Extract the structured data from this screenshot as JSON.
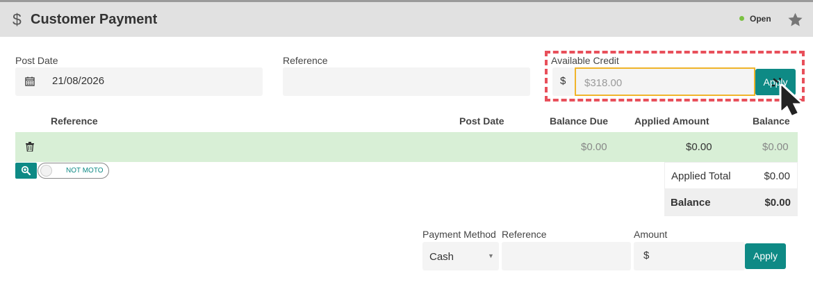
{
  "header": {
    "currency_symbol": "$",
    "title": "Customer Payment",
    "status": "Open",
    "status_color": "#7ac142"
  },
  "form": {
    "post_date_label": "Post Date",
    "post_date_value": "21/08/2026",
    "reference_label": "Reference",
    "reference_value": "",
    "available_credit_label": "Available Credit",
    "available_credit_prefix": "$",
    "available_credit_placeholder": "$318.00",
    "apply_label": "Apply"
  },
  "table": {
    "headers": [
      "Reference",
      "Post Date",
      "Balance Due",
      "Applied Amount",
      "Balance"
    ],
    "rows": [
      {
        "reference": "",
        "post_date": "",
        "balance_due": "$0.00",
        "applied_amount": "$0.00",
        "balance": "$0.00"
      }
    ]
  },
  "moto_toggle_label": "NOT MOTO",
  "totals": {
    "applied_total_label": "Applied Total",
    "applied_total_value": "$0.00",
    "balance_label": "Balance",
    "balance_value": "$0.00"
  },
  "payment": {
    "method_label": "Payment Method",
    "method_value": "Cash",
    "reference_label": "Reference",
    "amount_label": "Amount",
    "amount_prefix": "$",
    "apply_label": "Apply"
  },
  "colors": {
    "accent": "#0e8a85",
    "row_highlight": "#d8efd6",
    "highlight_border": "#e8505b",
    "focus_border": "#f0b429"
  },
  "icons": [
    "dollar-icon",
    "star-icon",
    "calendar-icon",
    "trash-icon",
    "zoom-in-icon",
    "mouse-cursor-icon"
  ]
}
